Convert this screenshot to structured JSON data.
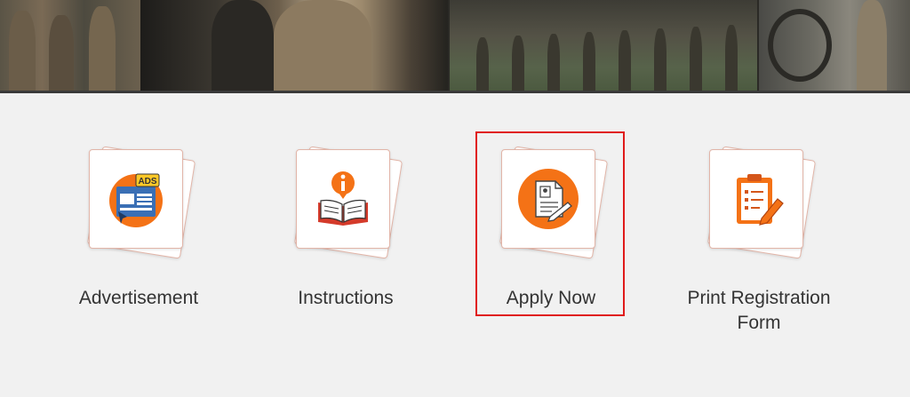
{
  "tiles": [
    {
      "label": "Advertisement",
      "icon": "advertisement-ads-icon",
      "ads_badge": "ADS"
    },
    {
      "label": "Instructions",
      "icon": "info-book-icon"
    },
    {
      "label": "Apply Now",
      "icon": "apply-document-icon",
      "highlighted": true
    },
    {
      "label": "Print Registration Form",
      "icon": "clipboard-pencil-icon"
    }
  ],
  "colors": {
    "accent": "#f47216",
    "highlight_border": "#e01b1b",
    "card_border": "#e2b5a8",
    "label_text": "#333333",
    "background": "#f1f1f1"
  }
}
